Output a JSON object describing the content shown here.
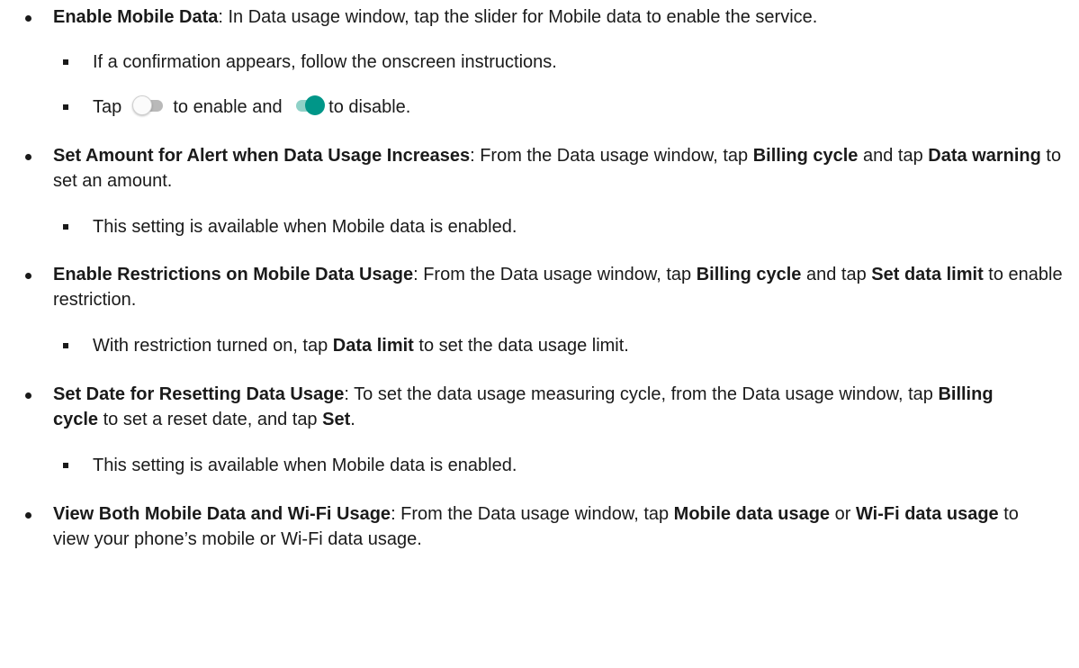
{
  "items": [
    {
      "title": "Enable Mobile Data",
      "text": ": In Data usage window, tap the slider for Mobile data to enable the service.",
      "subs": [
        {
          "text": "If a confirmation appears, follow the onscreen instructions."
        },
        {
          "pre": "Tap",
          "mid": "to enable and",
          "post": "to disable.",
          "icons": [
            "toggle-off-icon",
            "toggle-on-icon"
          ]
        }
      ]
    },
    {
      "title": "Set Amount for Alert when Data Usage Increases",
      "t1": ": From the Data usage window, tap ",
      "b1": "Billing cycle",
      "t2": " and tap ",
      "b2": "Data warning",
      "t3": " to set an amount.",
      "subs": [
        {
          "text": "This setting is available when Mobile data is enabled."
        }
      ]
    },
    {
      "title": "Enable Restrictions on Mobile Data Usage",
      "t1": ": From the Data usage window, tap ",
      "b1": "Billing cycle",
      "t2": " and tap ",
      "b2": "Set data limit",
      "t3": " to enable restriction.",
      "subs": [
        {
          "pre": "With restriction turned on, tap ",
          "bold": "Data limit",
          "post": " to set the data usage limit."
        }
      ]
    },
    {
      "title": "Set Date for Resetting Data Usage",
      "t1": ": To set the data usage measuring cycle, from the Data usage window, tap ",
      "b1": "Billing cycle",
      "t2": " to set a reset date, and tap ",
      "b2": "Set",
      "t3": ".",
      "subs": [
        {
          "text": "This setting is available when Mobile data is enabled."
        }
      ]
    },
    {
      "title": "View Both Mobile Data and Wi-Fi Usage",
      "t1": ": From the Data usage window, tap ",
      "b1": "Mobile data usage",
      "t2": " or ",
      "b2": "Wi-Fi data usage",
      "t3": " to view your phone’s mobile or Wi-Fi data usage."
    }
  ],
  "colors": {
    "text": "#1a1a1a",
    "toggle_on_knob": "#009688",
    "toggle_on_track": "#8fd1c7",
    "toggle_off_track": "#b9b9b9"
  }
}
